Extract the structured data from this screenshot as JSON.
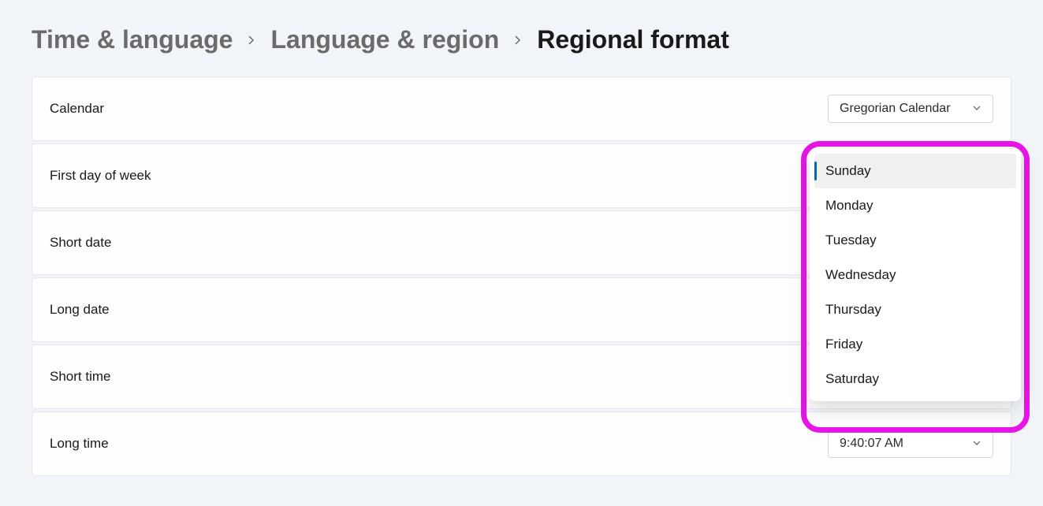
{
  "breadcrumb": {
    "item1": "Time & language",
    "item2": "Language & region",
    "current": "Regional format"
  },
  "settings": {
    "calendar": {
      "label": "Calendar",
      "value": "Gregorian Calendar"
    },
    "first_day": {
      "label": "First day of week",
      "options": [
        "Sunday",
        "Monday",
        "Tuesday",
        "Wednesday",
        "Thursday",
        "Friday",
        "Saturday"
      ]
    },
    "short_date": {
      "label": "Short date"
    },
    "long_date": {
      "label": "Long date"
    },
    "short_time": {
      "label": "Short time"
    },
    "long_time": {
      "label": "Long time",
      "value": "9:40:07 AM"
    }
  }
}
